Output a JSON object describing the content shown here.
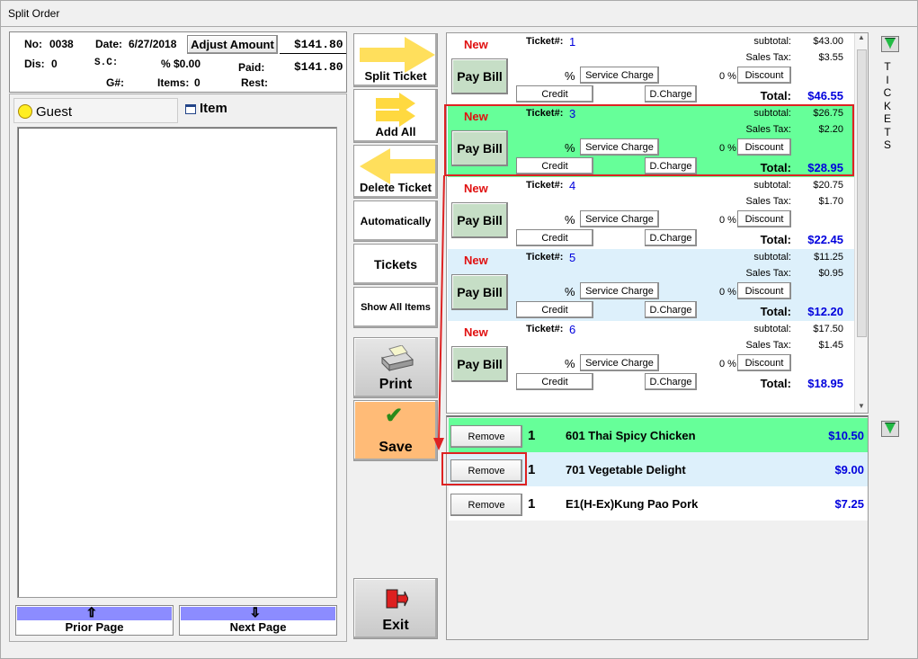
{
  "window": {
    "title": "Split Order"
  },
  "header": {
    "no_label": "No:",
    "no_value": "0038",
    "date_label": "Date:",
    "date_value": "6/27/2018",
    "adjust_label": "Adjust Amount",
    "amount": "$141.80",
    "dis_label": "Dis:",
    "dis_value": "0",
    "sc_label": "S.C:",
    "sc_pct": "% $0.00",
    "paid_label": "Paid:",
    "paid_value": "$141.80",
    "g_label": "G#:",
    "items_label": "Items:",
    "items_value": "0",
    "rest_label": "Rest:"
  },
  "guest_panel": {
    "guest_tab": "Guest",
    "item_tab": "Item"
  },
  "paging": {
    "prior": "Prior Page",
    "next": "Next Page"
  },
  "side_buttons": {
    "split_ticket": "Split Ticket",
    "add_all": "Add All",
    "delete_ticket": "Delete Ticket",
    "automatically": "Automatically",
    "tickets": "Tickets",
    "show_all_items": "Show All Items",
    "print": "Print",
    "save": "Save",
    "exit": "Exit"
  },
  "ticket_labels": {
    "new": "New",
    "ticket": "Ticket#:",
    "pay_bill": "Pay Bill",
    "pct": "%",
    "service_charge": "Service Charge",
    "pct_zero": "0 %",
    "discount": "Discount",
    "credit": "Credit",
    "dcharge": "D.Charge",
    "subtotal": "subtotal:",
    "sales_tax": "Sales Tax:",
    "total": "Total:"
  },
  "tickets": [
    {
      "num": "1",
      "subtotal": "$43.00",
      "tax": "$3.55",
      "total": "$46.55"
    },
    {
      "num": "3",
      "subtotal": "$26.75",
      "tax": "$2.20",
      "total": "$28.95"
    },
    {
      "num": "4",
      "subtotal": "$20.75",
      "tax": "$1.70",
      "total": "$22.45"
    },
    {
      "num": "5",
      "subtotal": "$11.25",
      "tax": "$0.95",
      "total": "$12.20"
    },
    {
      "num": "6",
      "subtotal": "$17.50",
      "tax": "$1.45",
      "total": "$18.95"
    }
  ],
  "items": [
    {
      "remove": "Remove",
      "qty": "1",
      "name": "601 Thai Spicy Chicken",
      "price": "$10.50"
    },
    {
      "remove": "Remove",
      "qty": "1",
      "name": "701 Vegetable Delight",
      "price": "$9.00"
    },
    {
      "remove": "Remove",
      "qty": "1",
      "name": "E1(H-Ex)Kung Pao Pork",
      "price": "$7.25"
    }
  ],
  "tickets_vertical": "TICKETS",
  "colors": {
    "selected_ticket": "#66ff99",
    "alt_ticket": "#ddf0fb",
    "save_btn": "#ffbb77",
    "page_btn": "#8c8cff",
    "highlight": "#dd2222"
  }
}
